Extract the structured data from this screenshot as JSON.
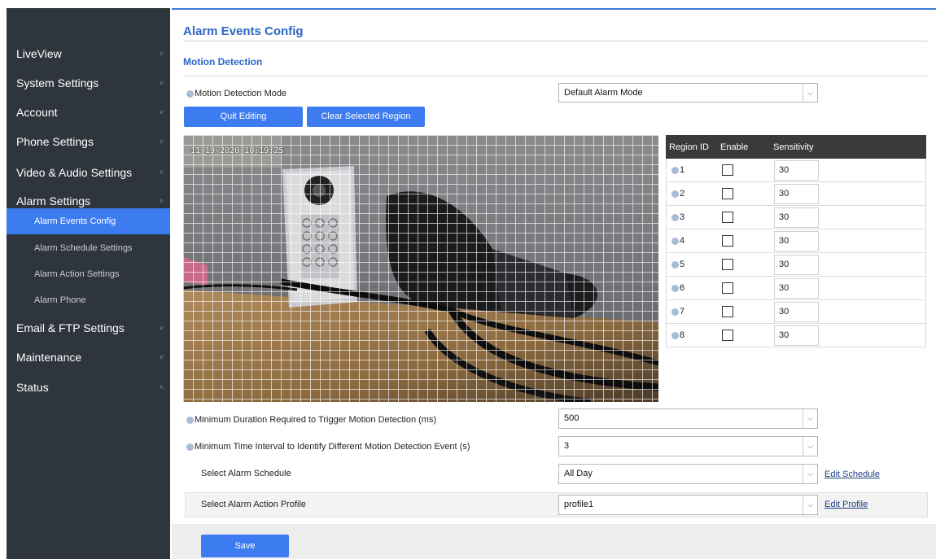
{
  "sidebar": {
    "items": [
      {
        "label": "LiveView",
        "chevron": "˅"
      },
      {
        "label": "System Settings",
        "chevron": "˅"
      },
      {
        "label": "Account",
        "chevron": "˅"
      },
      {
        "label": "Phone Settings",
        "chevron": "˅"
      },
      {
        "label": "Video & Audio Settings",
        "chevron": "˄"
      },
      {
        "label": "Alarm Settings",
        "chevron": "˄"
      },
      {
        "label": "Email & FTP Settings",
        "chevron": "˅"
      },
      {
        "label": "Maintenance",
        "chevron": "˅"
      },
      {
        "label": "Status",
        "chevron": "˄"
      }
    ],
    "alarm_sub_items": [
      {
        "label": "Alarm Events Config",
        "active": true
      },
      {
        "label": "Alarm Schedule Settings",
        "active": false
      },
      {
        "label": "Alarm Action Settings",
        "active": false
      },
      {
        "label": "Alarm Phone",
        "active": false
      }
    ]
  },
  "main": {
    "page_title": "Alarm Events Config",
    "section_title": "Motion Detection",
    "motion_mode": {
      "label": "Motion Detection Mode",
      "value": "Default Alarm Mode"
    },
    "quit_editing_label": "Quit Editing",
    "clear_region_label": "Clear Selected Region",
    "camera_timestamp": "11-19-2020  10:19:25",
    "region_table": {
      "headers": [
        "Region ID",
        "Enable",
        "Sensitivity"
      ],
      "rows": [
        {
          "id": "1",
          "enabled": false,
          "sensitivity": "30"
        },
        {
          "id": "2",
          "enabled": false,
          "sensitivity": "30"
        },
        {
          "id": "3",
          "enabled": false,
          "sensitivity": "30"
        },
        {
          "id": "4",
          "enabled": false,
          "sensitivity": "30"
        },
        {
          "id": "5",
          "enabled": false,
          "sensitivity": "30"
        },
        {
          "id": "6",
          "enabled": false,
          "sensitivity": "30"
        },
        {
          "id": "7",
          "enabled": false,
          "sensitivity": "30"
        },
        {
          "id": "8",
          "enabled": false,
          "sensitivity": "30"
        }
      ]
    },
    "min_duration": {
      "label": "Minimum Duration Required to Trigger Motion Detection (ms)",
      "value": "500"
    },
    "min_interval": {
      "label": "Minimum Time Interval to Identify Different Motion Detection Event (s)",
      "value": "3"
    },
    "alarm_schedule": {
      "label": "Select Alarm Schedule",
      "value": "All Day",
      "link": "Edit Schedule"
    },
    "action_profile": {
      "label": "Select Alarm Action Profile",
      "value": "profile1",
      "link": "Edit Profile"
    },
    "save_label": "Save"
  },
  "colors": {
    "accent": "#3d7cf0",
    "sidebar_bg": "#2f353d",
    "title_blue": "#2a66c5"
  }
}
